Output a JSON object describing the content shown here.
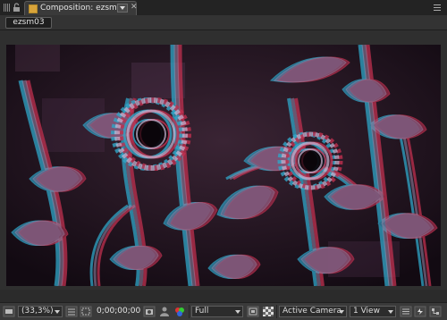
{
  "panel": {
    "tab_title": "Composition: ezsm03",
    "sub_tab": "ezsm03"
  },
  "toolbar": {
    "zoom": "(33,3%)",
    "timecode": "0;00;00;00",
    "resolution": "Full",
    "camera": "Active Camera",
    "views": "1 View"
  },
  "colors": {
    "anaglyph_red": "#c0304f",
    "anaglyph_cyan": "#2fa6c8",
    "tab_icon": "#d9a43a"
  }
}
